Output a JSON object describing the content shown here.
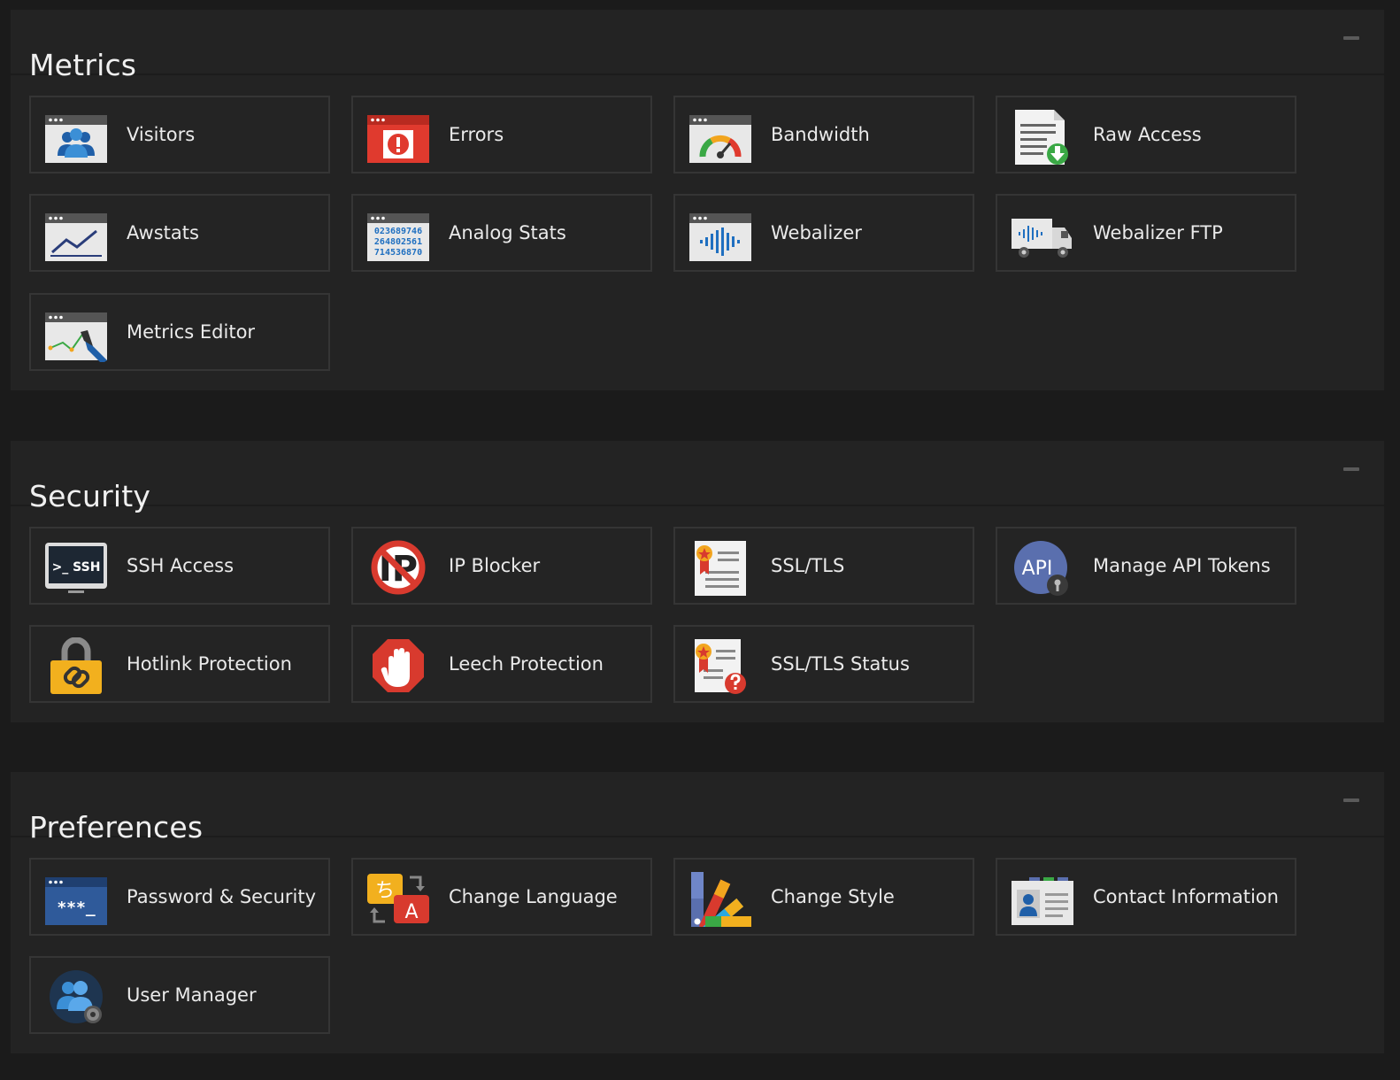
{
  "sections": [
    {
      "title": "Metrics",
      "items": [
        {
          "label": "Visitors",
          "icon": "visitors-icon"
        },
        {
          "label": "Errors",
          "icon": "errors-icon"
        },
        {
          "label": "Bandwidth",
          "icon": "bandwidth-icon"
        },
        {
          "label": "Raw Access",
          "icon": "raw-access-icon"
        },
        {
          "label": "Awstats",
          "icon": "awstats-icon"
        },
        {
          "label": "Analog Stats",
          "icon": "analog-stats-icon"
        },
        {
          "label": "Webalizer",
          "icon": "webalizer-icon"
        },
        {
          "label": "Webalizer FTP",
          "icon": "webalizer-ftp-icon"
        },
        {
          "label": "Metrics Editor",
          "icon": "metrics-editor-icon"
        }
      ]
    },
    {
      "title": "Security",
      "items": [
        {
          "label": "SSH Access",
          "icon": "ssh-access-icon",
          "icon_text": ">_ SSH"
        },
        {
          "label": "IP Blocker",
          "icon": "ip-blocker-icon",
          "icon_text": "IP"
        },
        {
          "label": "SSL/TLS",
          "icon": "ssl-tls-icon"
        },
        {
          "label": "Manage API Tokens",
          "icon": "api-tokens-icon",
          "icon_text": "API"
        },
        {
          "label": "Hotlink Protection",
          "icon": "hotlink-protection-icon"
        },
        {
          "label": "Leech Protection",
          "icon": "leech-protection-icon"
        },
        {
          "label": "SSL/TLS Status",
          "icon": "ssl-tls-status-icon"
        }
      ]
    },
    {
      "title": "Preferences",
      "items": [
        {
          "label": "Password & Security",
          "icon": "password-security-icon",
          "icon_text": "***_"
        },
        {
          "label": "Change Language",
          "icon": "change-language-icon",
          "icon_text": [
            "ち",
            "A"
          ]
        },
        {
          "label": "Change Style",
          "icon": "change-style-icon"
        },
        {
          "label": "Contact Information",
          "icon": "contact-information-icon"
        },
        {
          "label": "User Manager",
          "icon": "user-manager-icon"
        }
      ]
    }
  ],
  "analog_digits": [
    "023689746",
    "264802561",
    "714536870"
  ]
}
